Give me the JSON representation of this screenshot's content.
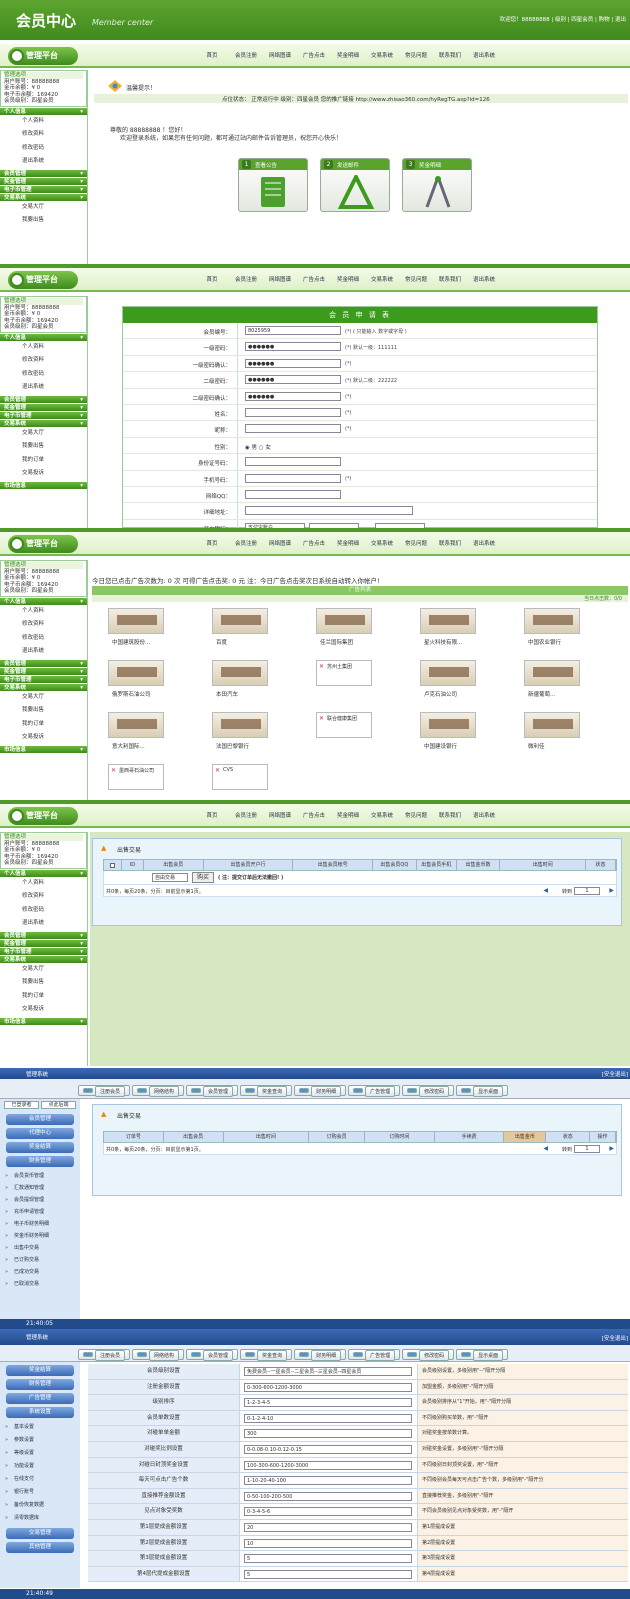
{
  "header": {
    "title": "会员中心",
    "subtitle": "Member center",
    "welcome": "欢迎您！88888888 | 级别 | 四星会员 | 购物 | 退出"
  },
  "logo": {
    "text": "管理平台",
    "sub": "PLATFORM MANAGER"
  },
  "nav": [
    "首页",
    "会员注册",
    "网络图谱",
    "广告点击",
    "奖金明细",
    "交易系统",
    "常见问题",
    "联系我们",
    "退出系统"
  ],
  "sidebar": {
    "info": [
      "管理选项",
      "用户账号：88888888",
      "金币余额：¥ 0",
      "电子币余额：169420",
      "会员级别：四星会员"
    ],
    "sections": [
      {
        "title": "个人信息",
        "items": [
          "个人资料",
          "修改资料",
          "修改密码",
          "退出系统"
        ]
      },
      {
        "title": "会员管理",
        "items": []
      },
      {
        "title": "奖金管理",
        "items": []
      },
      {
        "title": "电子币管理",
        "items": []
      },
      {
        "title": "交易系统",
        "items": [
          "交易大厅",
          "我要出售",
          "我的订单",
          "交易投诉"
        ]
      },
      {
        "title": "市场信息",
        "items": []
      }
    ]
  },
  "p1": {
    "notice_title": "温馨提示！",
    "status_line": "点位状态： 正常运行中   级别：四星会员   您的推广链接 http://www.zhisao360.com/hyRegTG.asp?id=126",
    "greet_name": "88888888",
    "greet": "尊敬的 88888888 ！您好！",
    "greet_text": "欢迎登录系统，如果您有任何问题，都可通过站内邮件告诉管理员，祝您开心快乐！",
    "cards": [
      {
        "num": "1",
        "label": "查看公告"
      },
      {
        "num": "2",
        "label": "发送邮件"
      },
      {
        "num": "3",
        "label": "奖金明细"
      }
    ]
  },
  "p2": {
    "form_title": "会 员 申 请 表",
    "rows": [
      {
        "label": "会员编号：",
        "value": "8025959",
        "hint": "(*) ( 只能输入 数字或字母 )"
      },
      {
        "label": "一级密码：",
        "value": "●●●●●●",
        "hint": "(*) 默认一级：111111"
      },
      {
        "label": "一级密码确认：",
        "value": "●●●●●●",
        "hint": "(*)"
      },
      {
        "label": "二级密码：",
        "value": "●●●●●●",
        "hint": "(*) 默认二级：222222"
      },
      {
        "label": "二级密码确认：",
        "value": "●●●●●●",
        "hint": "(*)"
      },
      {
        "label": "姓名：",
        "value": "",
        "hint": "(*)"
      },
      {
        "label": "昵称：",
        "value": "",
        "hint": "(*)"
      },
      {
        "label": "性别：",
        "value": "◉ 男  ○ 女",
        "hint": ""
      },
      {
        "label": "身份证号码：",
        "value": "",
        "hint": ""
      },
      {
        "label": "手机号码：",
        "value": "",
        "hint": "(*)"
      },
      {
        "label": "网络QQ：",
        "value": "",
        "hint": ""
      },
      {
        "label": "详细地址：",
        "value": "",
        "hint": ""
      },
      {
        "label": "开户银行：",
        "value": "支付宝账户",
        "hint": "(*)"
      }
    ]
  },
  "p3": {
    "ad_notice": "今日您已点击广告次数为: 0  次   可得广告点击奖: 0  元   注：今日广告点击奖次日系统自动转入你帐户!",
    "ad_header": "广告列表",
    "ad_count": "当日点击数：0/0",
    "ads": [
      "中国建筑股份...",
      "百度",
      "佳兰国际集团",
      "星火科技有限...",
      "中国农业银行",
      "俄罗斯石油公司",
      "本田汽车",
      "苏州土集团",
      "卢克石油公司",
      "新疆葡萄...",
      "意大利国际...",
      "法国巴黎银行",
      "联合健康集团",
      "中国建设银行",
      "微利佳",
      "墨西哥石油公司",
      "CVS"
    ]
  },
  "p4": {
    "panel_title": "出售交易",
    "headers": [
      "",
      "ID",
      "出售会员",
      "出售会员开户行",
      "出售会员帐号",
      "出售会员QQ",
      "出售会员手机",
      "出售金币数",
      "出售时间",
      "状态"
    ],
    "select": "自由交易",
    "buy_btn": "购买",
    "note": "( 注：提交订单后无法撤回! )",
    "footer": "共0条，每页20条，分页：目前显示第1页。",
    "page_label": "转到",
    "page_val": "1"
  },
  "p5": {
    "topbar": "管理系统",
    "logout": "[安全退出]",
    "tabs": [
      "注册会员",
      "网络结构",
      "会员管理",
      "奖金查询",
      "财务明细",
      "广告管理",
      "修改密码",
      "显示桌面"
    ],
    "side_top": [
      "已登录者",
      "点此后端"
    ],
    "side_btns": [
      "会员管理",
      "代理中心",
      "奖金结算",
      "财务管理"
    ],
    "side_items": [
      "会员货币管理",
      "汇款通知管理",
      "会员提现管理",
      "充币申请管理",
      "电子币财务明细",
      "奖金币财务明细",
      "出售中交易",
      "已订购交易",
      "已成功交易",
      "已取消交易"
    ],
    "panel_title": "出售交易",
    "headers": [
      "订单号",
      "出售会员",
      "出售时间",
      "订购会员",
      "订购时间",
      "手续费",
      "出售金币",
      "状态",
      "操作"
    ],
    "footer": "共0条，每页20条，分页：目前显示第1页。",
    "page_label": "转到",
    "page_val": "1",
    "time": "21:40:05"
  },
  "p6": {
    "topbar": "管理系统",
    "logout": "[安全退出]",
    "tabs": [
      "注册会员",
      "网络结构",
      "会员管理",
      "奖金查询",
      "财务明细",
      "广告管理",
      "修改密码",
      "显示桌面"
    ],
    "side_btns": [
      "奖金结算",
      "财务管理",
      "广告管理",
      "系统设置"
    ],
    "side_items": [
      "基本设置",
      "参数设置",
      "等级设置",
      "功能设置",
      "在线支付",
      "银行账号",
      "备份恢复数据",
      "清零数据库"
    ],
    "side_bottom": [
      "交易管理",
      "其他管理"
    ],
    "rows": [
      {
        "label": "会员级别设置",
        "value": "免费会员--一星会员--二星会员--三星会员--四星会员",
        "hint": "会员级别设置，多级别用\"--\"隔开分隔"
      },
      {
        "label": "注册金额设置",
        "value": "0-300-600-1200-3000",
        "hint": "加盟金额，多级别用\"-\"隔开分隔"
      },
      {
        "label": "级别排序",
        "value": "1-2-3-4-5",
        "hint": "会员级别排序从\"1\"开始，用\"-\"隔开分隔"
      },
      {
        "label": "会员单数设置",
        "value": "0-1-2-4-10",
        "hint": "不同级别购买单数，用\"-\"隔开"
      },
      {
        "label": "对碰单单金额",
        "value": "300",
        "hint": "对碰奖金按单数计算。"
      },
      {
        "label": "对碰奖比例设置",
        "value": "0-0.08-0.10-0.12-0.15",
        "hint": "对碰奖金设置，多级别用\"-\"隔开分隔"
      },
      {
        "label": "对碰日封顶奖金设置",
        "value": "100-300-600-1200-3000",
        "hint": "不同级别日封顶奖设置，用\"-\"隔开"
      },
      {
        "label": "每天可点击广告个数",
        "value": "1-10-20-40-100",
        "hint": "不同级别会员每天可点击广告个数，多级别用\"-\"隔开分"
      },
      {
        "label": "直接推荐金额设置",
        "value": "0-50-100-200-500",
        "hint": "直接推荐奖金，多级别用\"-\"隔开"
      },
      {
        "label": "见点对象受奖数",
        "value": "0-3-4-5-6",
        "hint": "不同会员级别见点对象受奖数，用\"-\"隔开"
      },
      {
        "label": "第1层提成金额设置",
        "value": "20",
        "hint": "第1层提成设置"
      },
      {
        "label": "第2层提成金额设置",
        "value": "10",
        "hint": "第2层提成设置"
      },
      {
        "label": "第3层提成金额设置",
        "value": "5",
        "hint": "第3层提成设置"
      },
      {
        "label": "第4层代提成金额设置",
        "value": "5",
        "hint": "第4层提成设置"
      }
    ],
    "time": "21:40:49"
  }
}
